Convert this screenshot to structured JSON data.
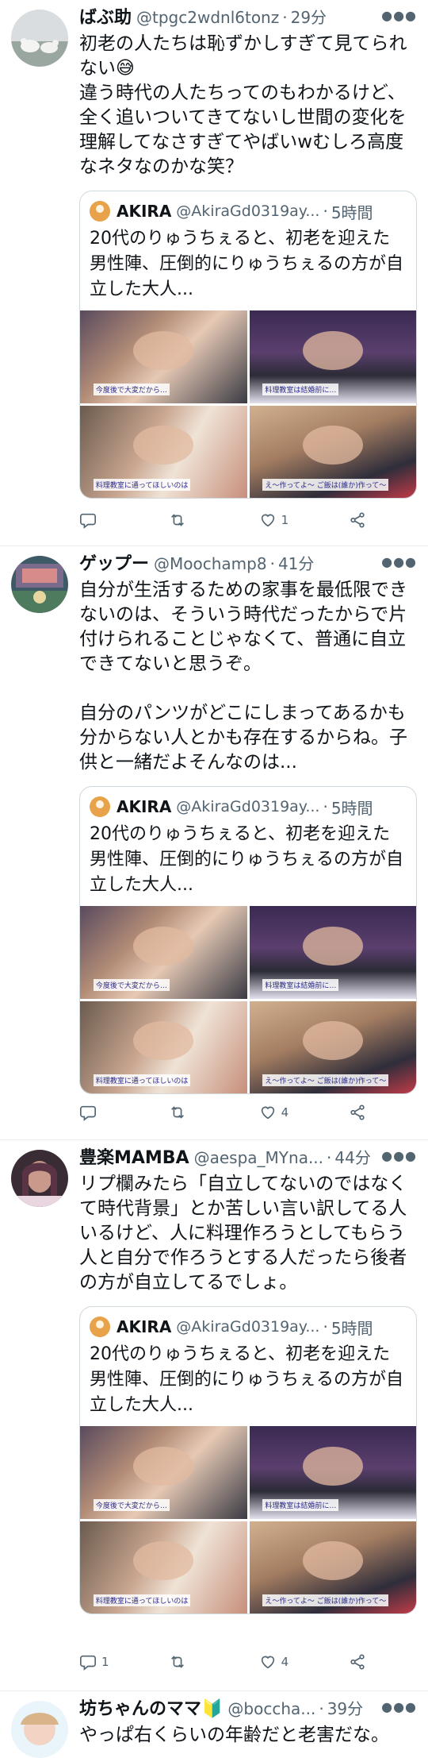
{
  "tweets": [
    {
      "name": "ばぶ助",
      "handle": "@tpgc2wdnl6tonz",
      "time": "29分",
      "text": "初老の人たちは恥ずかしすぎて見てられない😅\n違う時代の人たちってのもわかるけど、全く追いついてきてないし世間の変化を理解してなさすぎてやばいwむしろ高度なネタなのかな笑？",
      "quote": {
        "name": "AKIRA",
        "handle": "@AkiraGd0319ay...",
        "time": "5時間",
        "text": "20代のりゅうちぇると、初老を迎えた男性陣、圧倒的にりゅうちぇるの方が自立した大人..."
      },
      "counts": {
        "reply": "",
        "retweet": "",
        "like": "1"
      }
    },
    {
      "name": "ゲップー",
      "handle": "@Moochamp8",
      "time": "41分",
      "text": "自分が生活するための家事を最低限できないのは、そういう時代だったからで片付けられることじゃなくて、普通に自立できてないと思うぞ。\n\n自分のパンツがどこにしまってあるかも分からない人とかも存在するからね。子供と一緒だよそんなのは...",
      "quote": {
        "name": "AKIRA",
        "handle": "@AkiraGd0319ay...",
        "time": "5時間",
        "text": "20代のりゅうちぇると、初老を迎えた男性陣、圧倒的にりゅうちぇるの方が自立した大人..."
      },
      "counts": {
        "reply": "",
        "retweet": "",
        "like": "4"
      }
    },
    {
      "name": "豊楽MAMBA",
      "handle": "@aespa_MYna...",
      "time": "44分",
      "text": "リプ欄みたら「自立してないのではなくて時代背景」とか苦しい言い訳してる人いるけど、人に料理作ろうとしてもらう人と自分で作ろうとする人だったら後者の方が自立してるでしょ。",
      "quote": {
        "name": "AKIRA",
        "handle": "@AkiraGd0319ay...",
        "time": "5時間",
        "text": "20代のりゅうちぇると、初老を迎えた男性陣、圧倒的にりゅうちぇるの方が自立した大人..."
      },
      "counts": {
        "reply": "1",
        "retweet": "",
        "like": "4"
      }
    },
    {
      "name": "坊ちゃんのママ🔰",
      "handle": "@boccha...",
      "time": "39分",
      "text": "やっぱ右くらいの年齢だと老害だな。"
    }
  ],
  "image_captions": [
    "今度後で大変だから…",
    "料理教室は結婚前に…",
    "料理教室に通ってほしいのは",
    "え〜作ってよ〜 ご飯は(誰か)作って〜"
  ],
  "icons": {
    "reply": "reply-icon",
    "retweet": "retweet-icon",
    "like": "heart-icon",
    "share": "share-icon",
    "more": "more-icon"
  },
  "colors": {
    "text": "#0f1419",
    "secondary": "#536471",
    "border": "#cfd9de"
  }
}
